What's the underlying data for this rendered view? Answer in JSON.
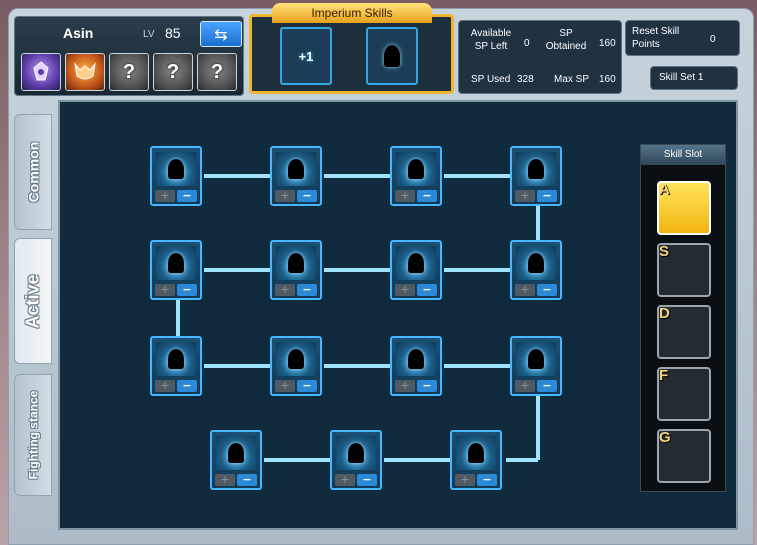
{
  "character": {
    "name": "Asin",
    "lv_label": "LV",
    "level": "85",
    "job_slots": [
      {
        "icon": "purple-class-emblem-icon",
        "color": "#5c3da8"
      },
      {
        "icon": "orange-class-emblem-icon",
        "color": "#c2571a"
      },
      {
        "icon": "locked-question-icon",
        "label": "?"
      },
      {
        "icon": "locked-question-icon",
        "label": "?"
      },
      {
        "icon": "locked-question-icon",
        "label": "?"
      }
    ]
  },
  "imperium": {
    "title": "Imperium Skills",
    "plus_label": "+1"
  },
  "sp": {
    "available_label": "Available SP Left",
    "available_value": "0",
    "obtained_label": "SP Obtained",
    "obtained_value": "160",
    "used_label": "SP Used",
    "used_value": "328",
    "max_label": "Max SP",
    "max_value": "160"
  },
  "reset": {
    "label": "Reset Skill Points",
    "value": "0"
  },
  "skill_set": {
    "label": "Skill Set 1"
  },
  "tabs": [
    {
      "label": "Common",
      "active": false
    },
    {
      "label": "Active",
      "active": true
    },
    {
      "label": "Fighting stance",
      "active": false
    }
  ],
  "skill_buttons": {
    "plus": "+",
    "minus": "−"
  },
  "skill_slot": {
    "title": "Skill Slot",
    "slots": [
      {
        "key": "A",
        "selected": true
      },
      {
        "key": "S",
        "selected": false
      },
      {
        "key": "D",
        "selected": false
      },
      {
        "key": "F",
        "selected": false
      },
      {
        "key": "G",
        "selected": false
      }
    ]
  },
  "colors": {
    "accent_blue": "#49b7ff",
    "imperium_gold": "#f0b52a",
    "selected_slot": "#ffd83a",
    "panel_dark": "#0f2b3d"
  }
}
